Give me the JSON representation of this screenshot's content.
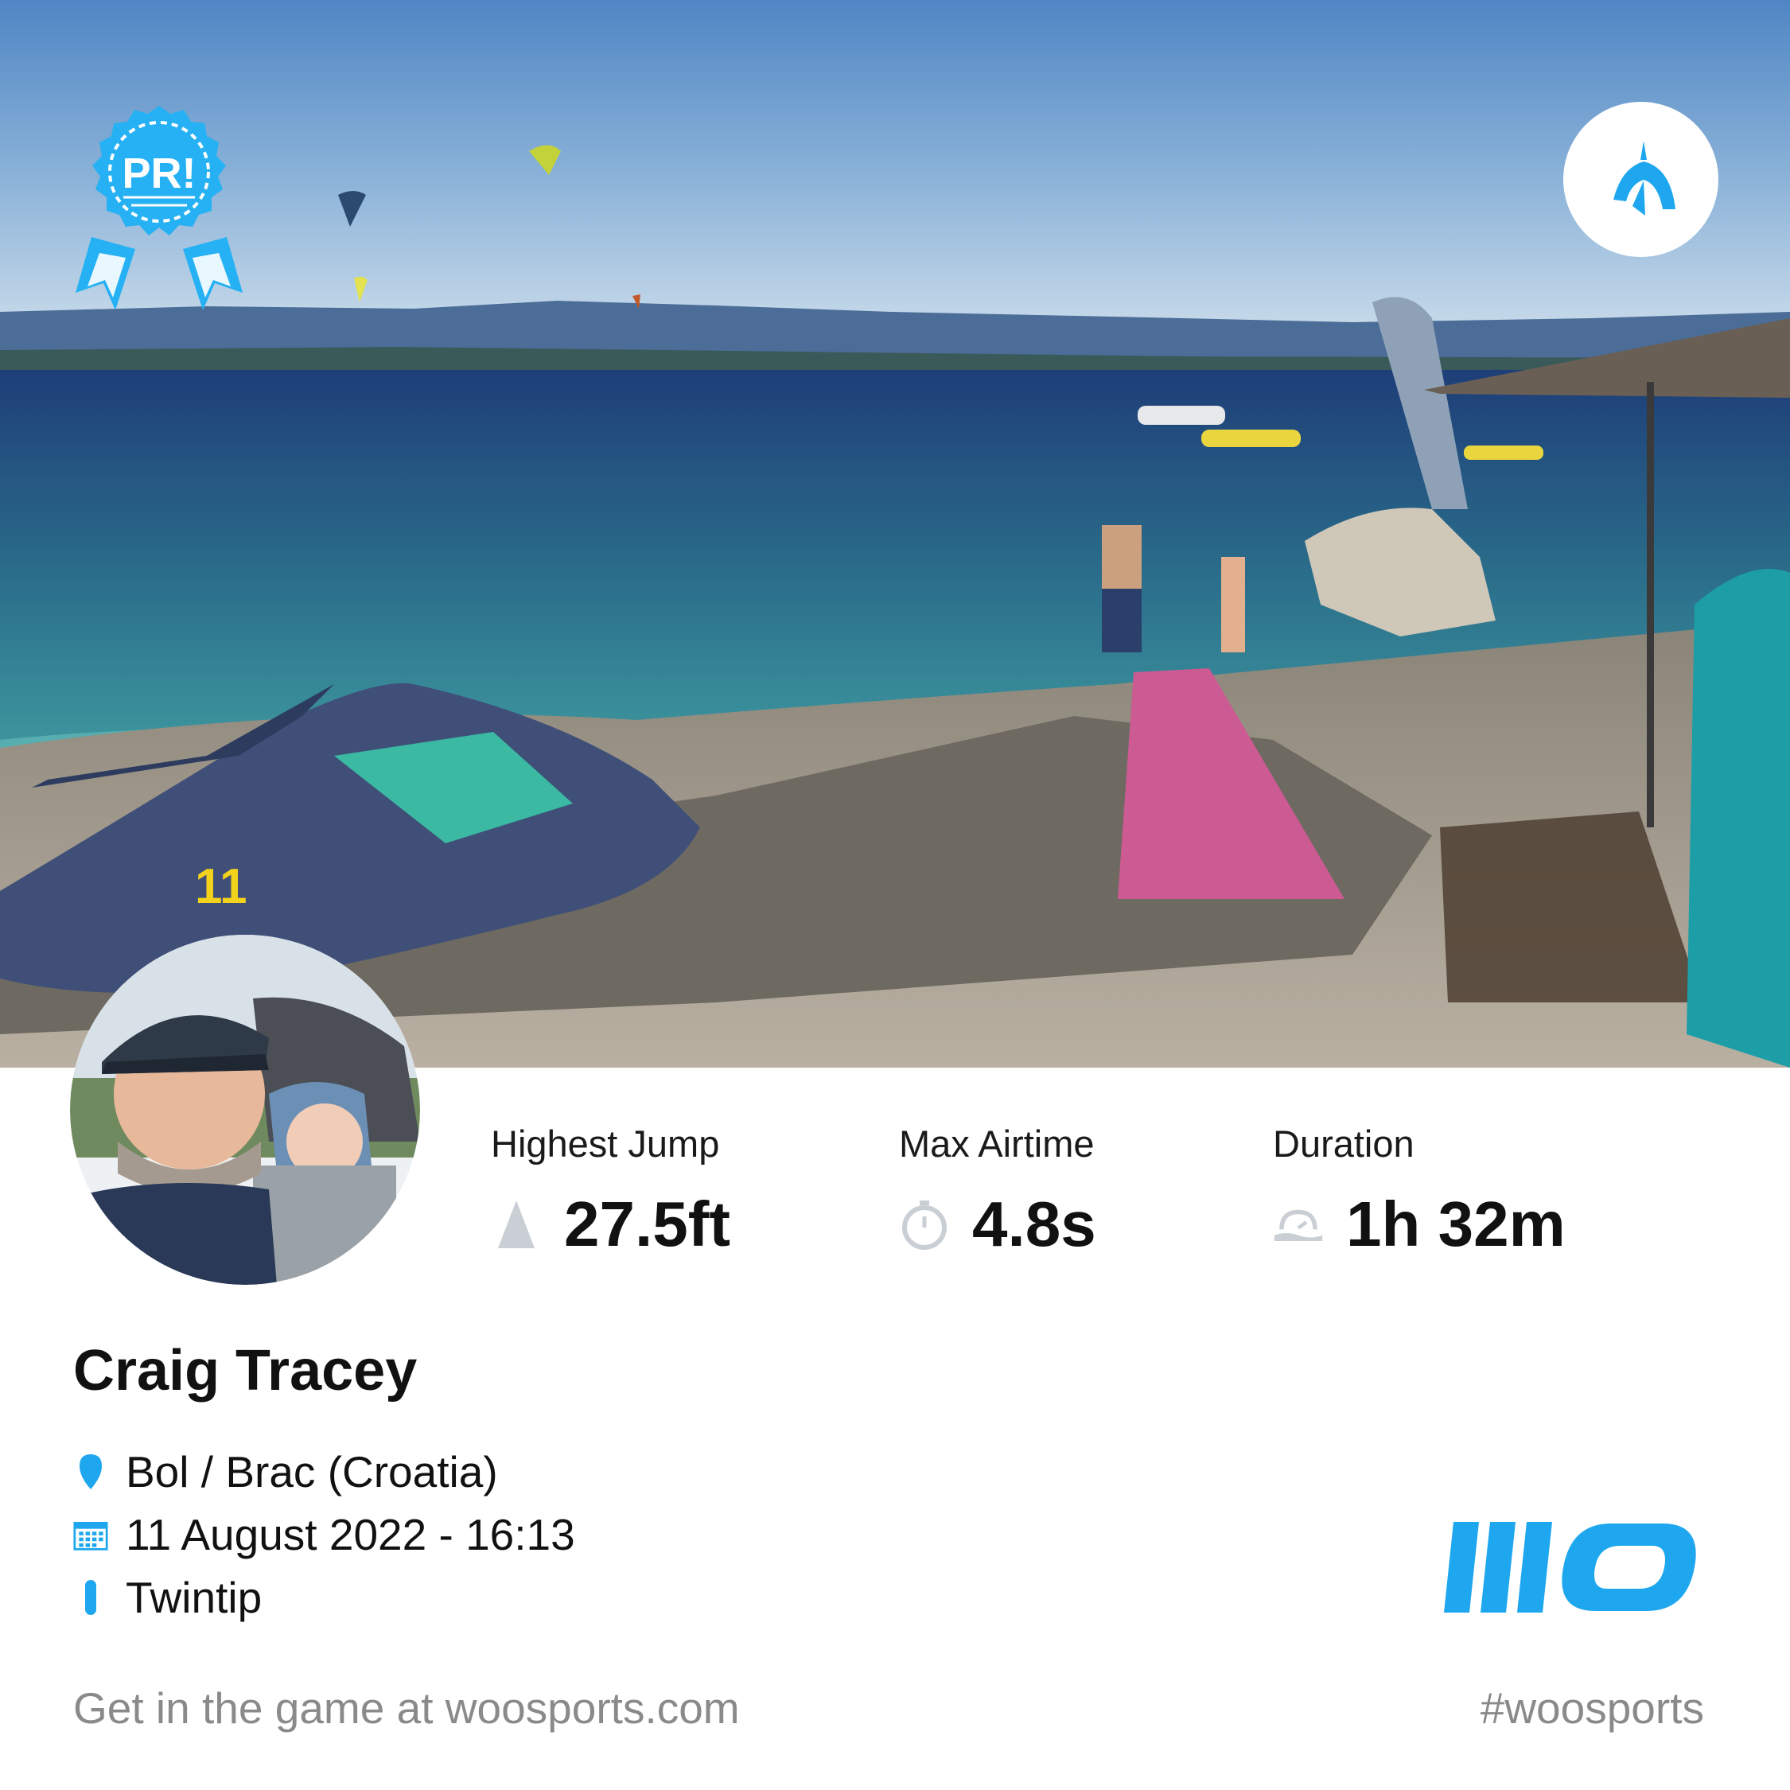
{
  "badges": {
    "pr_text": "PR!"
  },
  "stats": [
    {
      "label": "Highest Jump",
      "value": "27.5ft",
      "icon": "jump-height-icon"
    },
    {
      "label": "Max Airtime",
      "value": "4.8s",
      "icon": "stopwatch-icon"
    },
    {
      "label": "Duration",
      "value": "1h 32m",
      "icon": "duration-icon"
    }
  ],
  "profile": {
    "name": "Craig Tracey",
    "location": "Bol / Brac (Croatia)",
    "datetime": "11 August 2022 - 16:13",
    "board": "Twintip"
  },
  "footer": {
    "cta": "Get in the game at woosports.com",
    "hashtag": "#woosports"
  },
  "colors": {
    "accent": "#1ea7ef",
    "badge": "#25b1f3",
    "muted": "#8a8a8a",
    "icon_gray": "#c9cfd4"
  }
}
